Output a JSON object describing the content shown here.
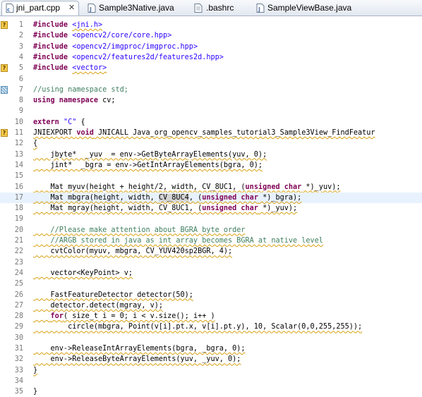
{
  "tabs": [
    {
      "label": "jni_part.cpp",
      "icon": "cpp-file-icon",
      "active": true,
      "close": "✕"
    },
    {
      "label": "Sample3Native.java",
      "icon": "java-file-icon",
      "active": false
    },
    {
      "label": ".bashrc",
      "icon": "text-file-icon",
      "active": false
    },
    {
      "label": "SampleViewBase.java",
      "icon": "java-file-icon",
      "active": false
    }
  ],
  "editor": {
    "current_line": 17,
    "lines": [
      {
        "n": "1",
        "marker": "warning",
        "tokens": [
          [
            "pp",
            "#include "
          ],
          [
            "inc sq",
            "<jni.h>"
          ]
        ]
      },
      {
        "n": "2",
        "tokens": [
          [
            "pp",
            "#include "
          ],
          [
            "inc",
            "<opencv2/core/core.hpp>"
          ]
        ]
      },
      {
        "n": "3",
        "tokens": [
          [
            "pp",
            "#include "
          ],
          [
            "inc",
            "<opencv2/imgproc/imgproc.hpp>"
          ]
        ]
      },
      {
        "n": "4",
        "tokens": [
          [
            "pp",
            "#include "
          ],
          [
            "inc",
            "<opencv2/features2d/features2d.hpp>"
          ]
        ]
      },
      {
        "n": "5",
        "marker": "warning",
        "tokens": [
          [
            "pp",
            "#include "
          ],
          [
            "inc sq",
            "<vector>"
          ]
        ]
      },
      {
        "n": "6",
        "tokens": []
      },
      {
        "n": "7",
        "marker": "fold",
        "tokens": [
          [
            "cm",
            "//using namespace std;"
          ]
        ]
      },
      {
        "n": "8",
        "tokens": [
          [
            "kw",
            "using namespace "
          ],
          [
            "",
            "cv;"
          ]
        ]
      },
      {
        "n": "9",
        "tokens": []
      },
      {
        "n": "10",
        "tokens": [
          [
            "kw",
            "extern "
          ],
          [
            "str",
            "\"C\""
          ],
          [
            "",
            " {"
          ]
        ]
      },
      {
        "n": "11",
        "marker": "warning",
        "tokens": [
          [
            "sq",
            "JNIEXPORT "
          ],
          [
            "kw sq",
            "void"
          ],
          [
            "sq",
            " JNICALL Java_org_opencv_samples_tutorial3_Sample3View_FindFeatur"
          ]
        ]
      },
      {
        "n": "12",
        "tokens": [
          [
            "sq",
            "{"
          ]
        ]
      },
      {
        "n": "13",
        "tokens": [
          [
            "sq",
            "    jbyte*  _yuv  = env->GetByteArrayElements(yuv, 0);"
          ]
        ]
      },
      {
        "n": "14",
        "tokens": [
          [
            "sq",
            "    jint*  _bgra = env->GetIntArrayElements(bgra, 0);"
          ]
        ]
      },
      {
        "n": "15",
        "tokens": []
      },
      {
        "n": "16",
        "tokens": [
          [
            "sq",
            "    Mat myuv(height + height/2, width, CV_8UC1, ("
          ],
          [
            "kw sq",
            "unsigned char"
          ],
          [
            "sq",
            " *)_yuv);"
          ]
        ]
      },
      {
        "n": "17",
        "tokens": [
          [
            "sq",
            "    Mat mbgra(height, width, "
          ],
          [
            "hl sq",
            "CV_8UC4"
          ],
          [
            "sq",
            ", ("
          ],
          [
            "kw sq",
            "unsigned char"
          ],
          [
            "sq",
            " *)_bgra);"
          ]
        ]
      },
      {
        "n": "18",
        "tokens": [
          [
            "sq",
            "    Mat mgray(height, width, CV_8UC1, ("
          ],
          [
            "kw sq",
            "unsigned char"
          ],
          [
            "sq",
            " *)_yuv);"
          ]
        ]
      },
      {
        "n": "19",
        "tokens": []
      },
      {
        "n": "20",
        "tokens": [
          [
            "cm sq",
            "    //Please make attention about BGRA byte order"
          ]
        ]
      },
      {
        "n": "21",
        "tokens": [
          [
            "cm sq",
            "    //ARGB stored in java as int array becomes BGRA at native level"
          ]
        ]
      },
      {
        "n": "22",
        "tokens": [
          [
            "sq",
            "    cvtColor(myuv, mbgra, CV_YUV420sp2BGR, 4);"
          ]
        ]
      },
      {
        "n": "23",
        "tokens": []
      },
      {
        "n": "24",
        "tokens": [
          [
            "sq",
            "    vector<KeyPoint> v;"
          ]
        ]
      },
      {
        "n": "25",
        "tokens": []
      },
      {
        "n": "26",
        "tokens": [
          [
            "sq",
            "    FastFeatureDetector detector(50);"
          ]
        ]
      },
      {
        "n": "27",
        "tokens": [
          [
            "sq",
            "    detector.detect(mgray, v);"
          ]
        ]
      },
      {
        "n": "28",
        "tokens": [
          [
            "sq",
            "    "
          ],
          [
            "kw sq",
            "for"
          ],
          [
            "sq",
            "( size_t i = 0; i < v.size(); i++ )"
          ]
        ]
      },
      {
        "n": "29",
        "tokens": [
          [
            "sq",
            "        circle(mbgra, Point(v[i].pt.x, v[i].pt.y), 10, Scalar(0,0,255,255));"
          ]
        ]
      },
      {
        "n": "30",
        "tokens": []
      },
      {
        "n": "31",
        "tokens": [
          [
            "sq",
            "    env->ReleaseIntArrayElements(bgra, _bgra, 0);"
          ]
        ]
      },
      {
        "n": "32",
        "tokens": [
          [
            "sq",
            "    env->ReleaseByteArrayElements(yuv, _yuv, 0);"
          ]
        ]
      },
      {
        "n": "33",
        "tokens": [
          [
            "sq",
            "}"
          ]
        ]
      },
      {
        "n": "34",
        "tokens": []
      },
      {
        "n": "35",
        "tokens": [
          [
            "",
            "}"
          ]
        ]
      }
    ]
  }
}
